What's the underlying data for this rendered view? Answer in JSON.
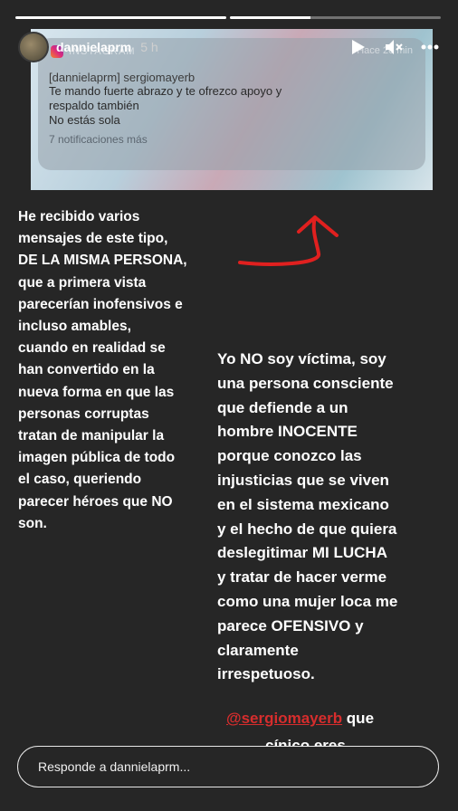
{
  "story": {
    "progress": [
      1.0,
      0.38
    ],
    "username": "dannielaprm",
    "time_ago": "5 h"
  },
  "icons": {
    "play": "play-icon",
    "mute": "mute-icon",
    "more": "more-options-icon"
  },
  "screenshot": {
    "app_name": "INSTAGRAM",
    "ago": "Hace 20 min",
    "title": "[dannielaprm] sergiomayerb",
    "lines": [
      "Te mando fuerte abrazo y te ofrezco apoyo y",
      "respaldo también",
      "No estás sola"
    ],
    "more": "7 notificaciones más"
  },
  "text_left": [
    "He recibido varios",
    "mensajes de este tipo,",
    "DE LA MISMA PERSONA,",
    "que a primera vista",
    "parecerían inofensivos e",
    "incluso amables,",
    "cuando en realidad se",
    "han convertido en la",
    "nueva forma en que las",
    "personas corruptas",
    "tratan de manipular la",
    "imagen pública de todo",
    "el caso, queriendo",
    "parecer héroes que NO",
    "son."
  ],
  "text_right": [
    "Yo NO soy víctima, soy",
    "una persona consciente",
    "que defiende a un",
    "hombre INOCENTE",
    "porque conozco las",
    "injusticias que se viven",
    "en el sistema mexicano",
    "y el hecho de que quiera",
    "deslegitimar MI LUCHA",
    "y tratar de hacer verme",
    "como una mujer loca me",
    "parece OFENSIVO y",
    "claramente",
    "irrespetuoso."
  ],
  "mention": {
    "handle": "@sergiomayerb",
    "rest": " que",
    "line2": "cínico eres."
  },
  "colors": {
    "arrow": "#e0201f",
    "mention": "#d62d2d",
    "background": "#262626"
  },
  "reply": {
    "placeholder": "Responde a dannielaprm..."
  }
}
